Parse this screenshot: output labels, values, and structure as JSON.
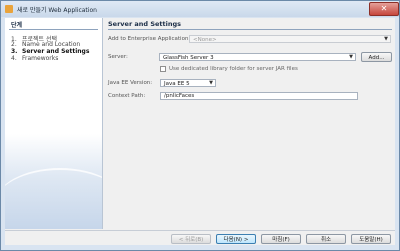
{
  "window": {
    "title": "새로 만들기 Web Application",
    "close_label": "✕"
  },
  "sidebar": {
    "heading": "단계",
    "steps": [
      {
        "num": "1.",
        "label": "프로젝트 선택"
      },
      {
        "num": "2.",
        "label": "Name and Location"
      },
      {
        "num": "3.",
        "label": "Server and Settings"
      },
      {
        "num": "4.",
        "label": "Frameworks"
      }
    ]
  },
  "panel": {
    "title": "Server and Settings",
    "enterprise": {
      "label": "Add to Enterprise Application:",
      "value": "<None>"
    },
    "server": {
      "label": "Server:",
      "value": "GlassFish Server 3",
      "add_label": "Add..."
    },
    "dedicated_library": {
      "label": "Use dedicated library folder for server JAR files",
      "checked": false
    },
    "java_ee": {
      "label": "Java EE Version:",
      "value": "Java EE 5"
    },
    "context_path": {
      "label": "Context Path:",
      "value": "/pnlicFaces"
    }
  },
  "footer": {
    "back": "< 뒤로(B)",
    "next": "다음(N) >",
    "finish": "마침(F)",
    "cancel": "취소",
    "help": "도움말(H)"
  }
}
